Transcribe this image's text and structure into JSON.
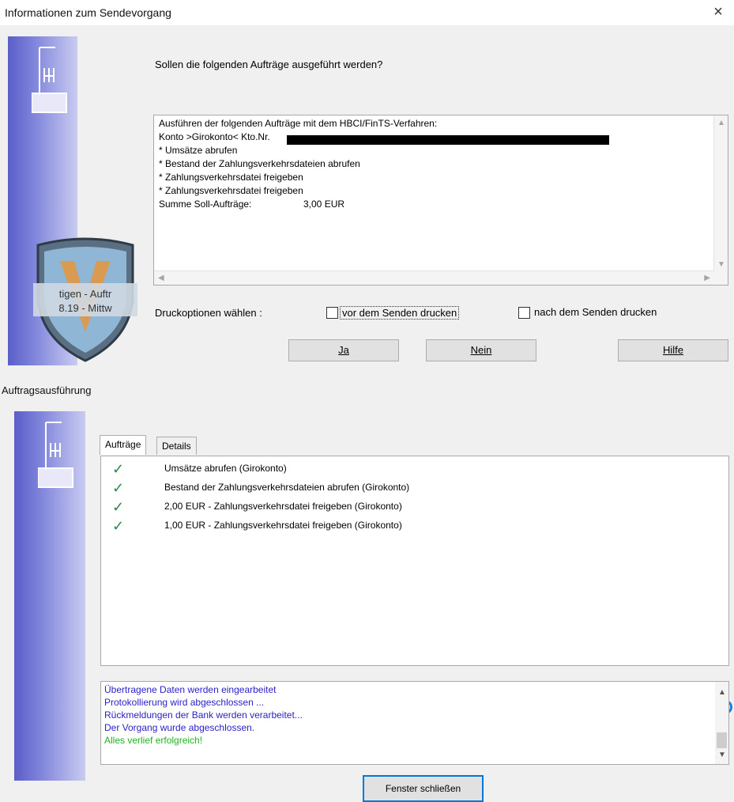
{
  "dialog1": {
    "title": "Informationen zum Sendevorgang",
    "close_glyph": "×",
    "question": "Sollen die folgenden Aufträge ausgeführt werden?",
    "info_lines": [
      "Ausführen der folgenden Aufträge mit dem HBCI/FinTS-Verfahren:",
      "Konto >Girokonto< Kto.Nr.",
      "* Umsätze abrufen",
      "* Bestand der Zahlungsverkehrsdateien abrufen",
      "* Zahlungsverkehrsdatei freigeben",
      "* Zahlungsverkehrsdatei freigeben",
      "Summe Soll-Aufträge:"
    ],
    "sum_amount": "3,00 EUR",
    "print_options_label": "Druckoptionen wählen :",
    "checkbox_before": "vor dem Senden drucken",
    "checkbox_after": "nach dem Senden drucken",
    "btn_yes": "Ja",
    "btn_no": "Nein",
    "btn_help": "Hilfe",
    "shield_text_1": "tigen - Auftr",
    "shield_text_2": "8.19 - Mittw"
  },
  "dialog2": {
    "title": "Auftragsausführung",
    "tabs": [
      "Aufträge",
      "Details"
    ],
    "tasks": [
      "Umsätze abrufen (Girokonto)",
      "Bestand der Zahlungsverkehrsdateien abrufen (Girokonto)",
      "2,00 EUR - Zahlungsverkehrsdatei freigeben (Girokonto)",
      "1,00 EUR - Zahlungsverkehrsdatei freigeben (Girokonto)"
    ],
    "log_lines": [
      "Übertragene Daten werden eingearbeitet",
      "Protokollierung wird abgeschlossen ...",
      "Rückmeldungen der Bank werden verarbeitet...",
      "Der Vorgang wurde abgeschlossen.",
      "Alles verlief erfolgreich!"
    ],
    "close_button": "Fenster schließen",
    "colors": {
      "log_text": "#2b22c8",
      "log_success": "#1fb21f",
      "check": "#2c8a4b"
    }
  }
}
